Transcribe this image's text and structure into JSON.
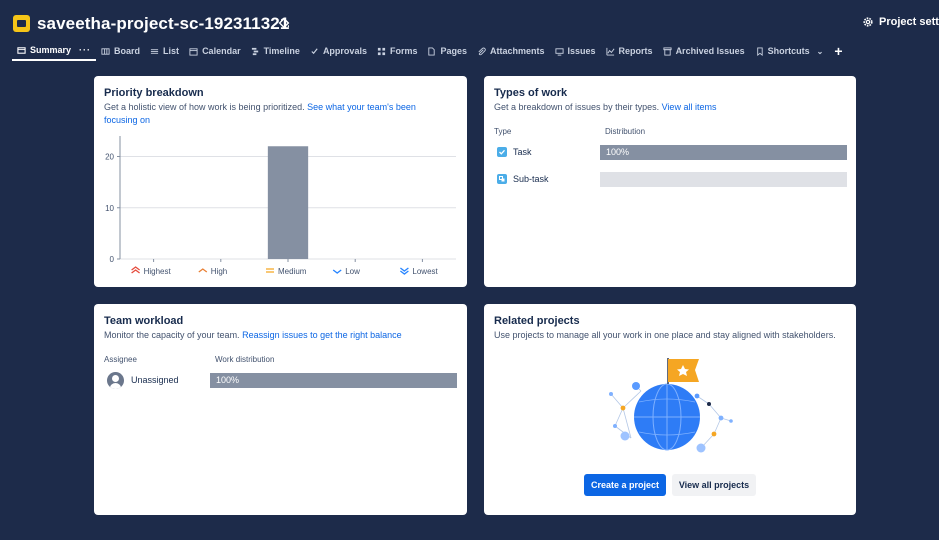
{
  "header": {
    "project_title": "saveetha-project-sc-192311321",
    "project_settings_label": "Project setting"
  },
  "tabs": [
    {
      "label": "Summary",
      "icon": "summary-icon",
      "active": true
    },
    {
      "label": "Board",
      "icon": "board-icon"
    },
    {
      "label": "List",
      "icon": "list-icon"
    },
    {
      "label": "Calendar",
      "icon": "calendar-icon"
    },
    {
      "label": "Timeline",
      "icon": "timeline-icon"
    },
    {
      "label": "Approvals",
      "icon": "approvals-icon"
    },
    {
      "label": "Forms",
      "icon": "forms-icon"
    },
    {
      "label": "Pages",
      "icon": "pages-icon"
    },
    {
      "label": "Attachments",
      "icon": "attachment-icon"
    },
    {
      "label": "Issues",
      "icon": "issues-icon"
    },
    {
      "label": "Reports",
      "icon": "reports-icon"
    },
    {
      "label": "Archived Issues",
      "icon": "archive-icon"
    },
    {
      "label": "Shortcuts",
      "icon": "shortcuts-icon"
    }
  ],
  "priority": {
    "title": "Priority breakdown",
    "desc_text": "Get a holistic view of how work is being prioritized. ",
    "desc_link_1": "See what your team's been",
    "desc_link_2": "focusing on"
  },
  "types": {
    "title": "Types of work",
    "desc_text": "Get a breakdown of issues by their types. ",
    "desc_link": "View all items",
    "col_type": "Type",
    "col_distribution": "Distribution",
    "rows": [
      {
        "label": "Task",
        "value_label": "100%",
        "fraction": 1.0
      },
      {
        "label": "Sub-task",
        "value_label": "",
        "fraction": 0.0
      }
    ]
  },
  "workload": {
    "title": "Team workload",
    "desc_text": "Monitor the capacity of your team. ",
    "desc_link": "Reassign issues to get the right balance",
    "col_assignee": "Assignee",
    "col_distribution": "Work distribution",
    "rows": [
      {
        "label": "Unassigned",
        "value_label": "100%",
        "fraction": 1.0
      }
    ]
  },
  "related": {
    "title": "Related projects",
    "desc_text": "Use projects to manage all your work in one place and stay aligned with stakeholders.",
    "create_button": "Create a project",
    "view_button": "View all projects"
  },
  "colors": {
    "header_bg": "#1d2b4a",
    "bar": "#8590a2",
    "accent": "#0c66e4",
    "highest": "#e5493a",
    "high": "#e97f33",
    "medium": "#f5a623",
    "low": "#2684ff",
    "lowest": "#2684ff"
  },
  "chart_data": {
    "type": "bar",
    "categories": [
      "Highest",
      "High",
      "Medium",
      "Low",
      "Lowest"
    ],
    "values": [
      0,
      0,
      22,
      0,
      0
    ],
    "yticks": [
      0,
      10,
      20
    ],
    "ylim": [
      0,
      24
    ],
    "grid": true
  }
}
